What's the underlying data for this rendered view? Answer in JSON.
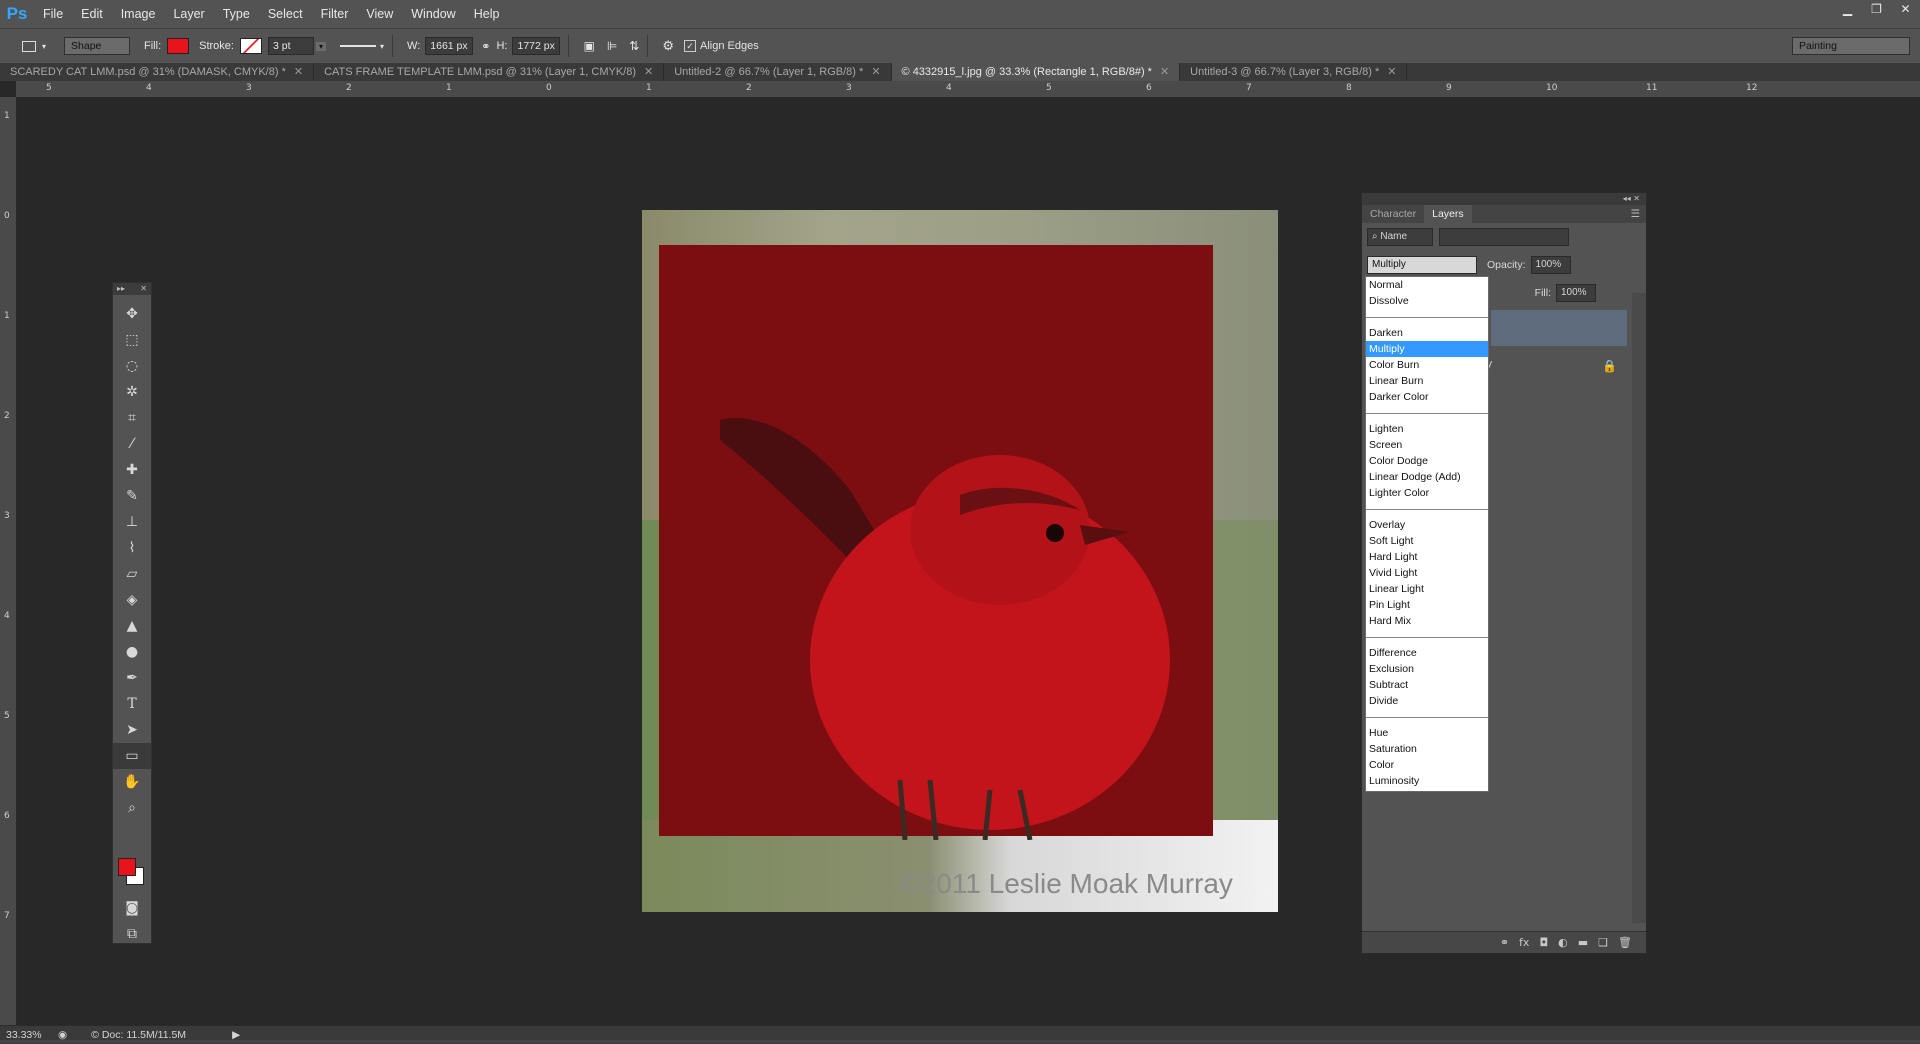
{
  "app": {
    "logo": "Ps"
  },
  "menu": [
    "File",
    "Edit",
    "Image",
    "Layer",
    "Type",
    "Select",
    "Filter",
    "View",
    "Window",
    "Help"
  ],
  "window_controls": {
    "minimize": "▁",
    "restore": "❐",
    "close": "✕"
  },
  "options": {
    "mode": "Shape",
    "fill_label": "Fill:",
    "fill_color": "#e8131b",
    "stroke_label": "Stroke:",
    "stroke_width": "3 pt",
    "w_label": "W:",
    "w_value": "1661 px",
    "h_label": "H:",
    "h_value": "1772 px",
    "align_edges": "Align Edges",
    "workspace": "Painting"
  },
  "tabs": [
    {
      "label": "SCAREDY CAT LMM.psd @ 31% (DAMASK, CMYK/8) *",
      "active": false
    },
    {
      "label": "CATS FRAME TEMPLATE LMM.psd @ 31% (Layer 1, CMYK/8)",
      "active": false
    },
    {
      "label": "Untitled-2 @ 66.7% (Layer 1, RGB/8) *",
      "active": false
    },
    {
      "label": "© 4332915_l.jpg @ 33.3% (Rectangle 1, RGB/8#) *",
      "active": true
    },
    {
      "label": "Untitled-3 @ 66.7% (Layer 3, RGB/8) *",
      "active": false
    }
  ],
  "ruler_top": [
    "5",
    "4",
    "3",
    "2",
    "1",
    "0",
    "1",
    "2",
    "3",
    "4",
    "5",
    "6",
    "7",
    "8",
    "9",
    "10",
    "11",
    "12"
  ],
  "ruler_left": [
    "1",
    "0",
    "1",
    "2",
    "3",
    "4",
    "5",
    "6",
    "7"
  ],
  "canvas": {
    "copyright": "©2011 Leslie Moak Murray"
  },
  "layers_panel": {
    "tabs": [
      "Character",
      "Layers"
    ],
    "filter_kind": "Name",
    "blend_mode": "Multiply",
    "opacity_label": "Opacity:",
    "opacity_value": "100%",
    "fill_label": "Fill:",
    "fill_value": "100%",
    "partial_layer_glyph": "y"
  },
  "blend_groups": [
    [
      "Normal",
      "Dissolve"
    ],
    [
      "Darken",
      "Multiply",
      "Color Burn",
      "Linear Burn",
      "Darker Color"
    ],
    [
      "Lighten",
      "Screen",
      "Color Dodge",
      "Linear Dodge (Add)",
      "Lighter Color"
    ],
    [
      "Overlay",
      "Soft Light",
      "Hard Light",
      "Vivid Light",
      "Linear Light",
      "Pin Light",
      "Hard Mix"
    ],
    [
      "Difference",
      "Exclusion",
      "Subtract",
      "Divide"
    ],
    [
      "Hue",
      "Saturation",
      "Color",
      "Luminosity"
    ]
  ],
  "selected_blend": "Multiply",
  "status": {
    "zoom": "33.33%",
    "doc": "Doc: 11.5M/11.5M"
  }
}
